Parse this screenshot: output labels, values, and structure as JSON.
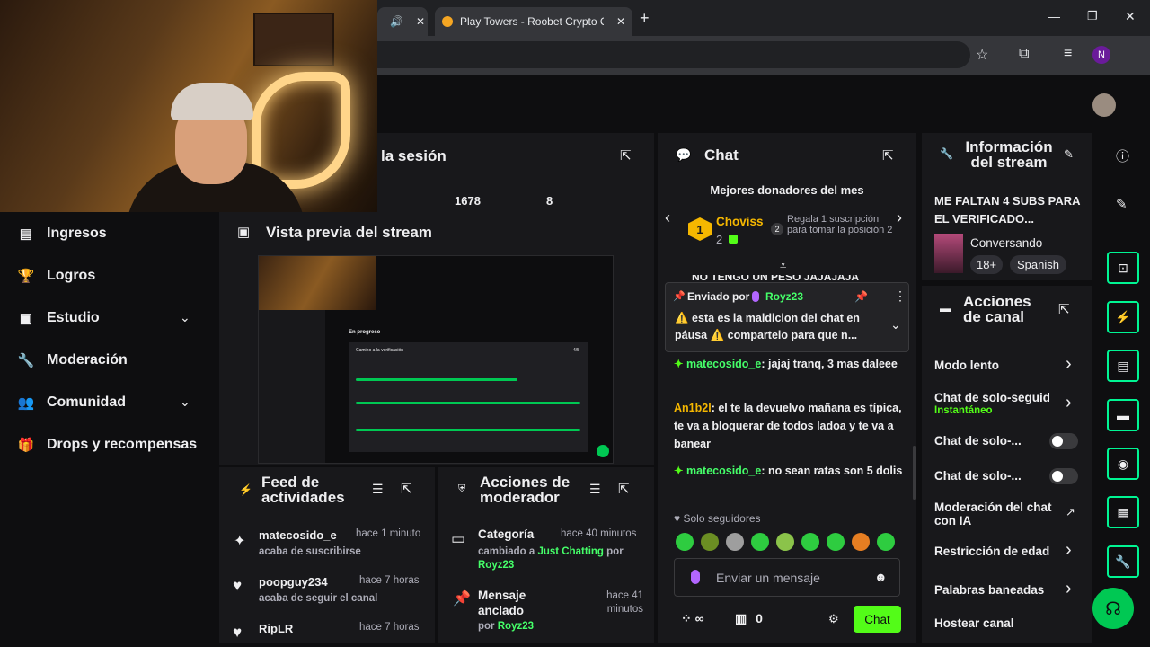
{
  "browser": {
    "tab_title": "Play Towers - Roobet Crypto Ca",
    "tab_close": "✕",
    "new_tab": "+",
    "profile_initial": "N"
  },
  "sidebar": {
    "items": [
      {
        "label": "Ingresos",
        "icon": "bar-chart-icon"
      },
      {
        "label": "Logros",
        "icon": "trophy-icon"
      },
      {
        "label": "Estudio",
        "icon": "video-icon"
      },
      {
        "label": "Moderación",
        "icon": "wrench-icon"
      },
      {
        "label": "Comunidad",
        "icon": "people-icon"
      },
      {
        "label": "Drops y recompensas",
        "icon": "gift-icon"
      }
    ]
  },
  "session": {
    "title": "la sesión",
    "stat1": "1678",
    "stat2": "8"
  },
  "preview": {
    "title": "Vista previa del stream",
    "inner_heading": "En progreso",
    "inner_item": "Camino a la verificación",
    "inner_count": "4/5"
  },
  "feed": {
    "title": "Feed de actividades",
    "items": [
      {
        "user": "matecosido_e",
        "time": "hace 1 minuto",
        "action": "acaba de suscribirse"
      },
      {
        "user": "poopguy234",
        "time": "hace 7 horas",
        "action": "acaba de seguir el canal"
      },
      {
        "user": "RipLR",
        "time": "hace 7 horas",
        "action": ""
      }
    ]
  },
  "modactions": {
    "title": "Acciones de moderador",
    "items": [
      {
        "title": "Categoría",
        "time": "hace 40 minutos",
        "pre": "cambiado a ",
        "category": "Just Chatting",
        "mid": " por ",
        "user": "Royz23"
      },
      {
        "title": "Mensaje anclado",
        "time": "hace 41 minutos",
        "pre": "por ",
        "user": "Royz23"
      }
    ]
  },
  "chat": {
    "title": "Chat",
    "top_donors_title": "Mejores donadores del mes",
    "donor_name": "Choviss",
    "donor_count": "2",
    "donor_rank": "1",
    "second_rank": "2",
    "second_text": "Regala 1 suscripción para tomar la posición 2",
    "partial_msg": "NO TENGO UN PESO JAJAJAJA",
    "pinned_label": "Enviado por",
    "pinned_user": "Royz23",
    "pinned_text": "⚠️ esta es la maldicion del chat en páusa ⚠️ compartelo para que n...",
    "messages": [
      {
        "user": "matecosido_e",
        "text": ": jajaj tranq, 3 mas daleee"
      },
      {
        "user": "An1b2l",
        "text": ": el te la devuelvo mañana es típica, te va a bloquerar de todos ladoa y te va a banear"
      },
      {
        "user": "matecosido_e",
        "text": ": no sean ratas son 5 dolis"
      }
    ],
    "followers_only": "Solo seguidores",
    "input_placeholder": "Enviar un mensaje",
    "points": "0",
    "send_label": "Chat"
  },
  "stream_info": {
    "title": "Información del stream",
    "stream_title": "ME FALTAN 4 SUBS PARA EL VERIFICADO...",
    "category": "Conversando",
    "tag1": "18+",
    "tag2": "Spanish"
  },
  "channel_actions": {
    "title": "Acciones de canal",
    "items": [
      {
        "label": "Modo lento"
      },
      {
        "label": "Chat de solo-seguidor",
        "sub": "Instantáneo"
      },
      {
        "label": "Chat de solo-..."
      },
      {
        "label": "Chat de solo-..."
      },
      {
        "label": "Moderación del chat con IA"
      },
      {
        "label": "Restricción de edad"
      },
      {
        "label": "Palabras baneadas"
      },
      {
        "label": "Hostear canal"
      }
    ]
  },
  "colors": {
    "accent": "#00f593",
    "kick_green": "#53fc18",
    "panel": "#18181b",
    "bg": "#0e0e10"
  }
}
